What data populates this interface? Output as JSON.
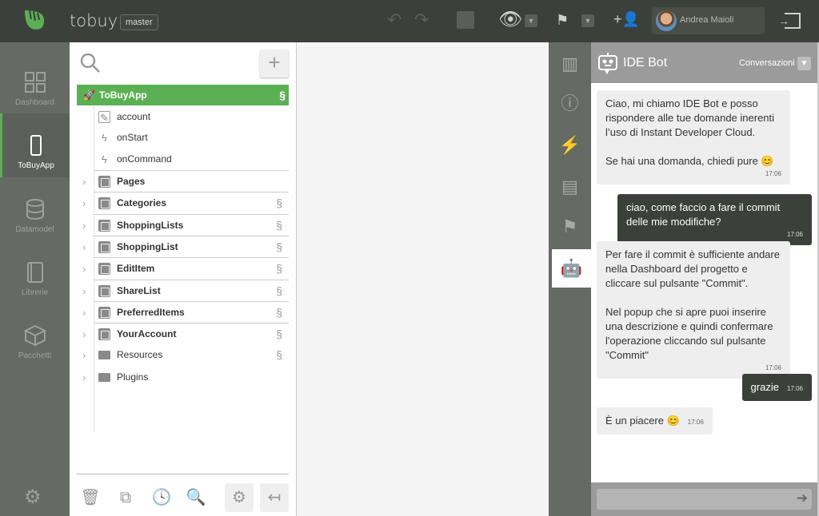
{
  "header": {
    "app_name": "tobuy",
    "branch": "master",
    "user_name": "Andrea Maioli",
    "icons": [
      "undo-icon",
      "redo-icon",
      "download-icon",
      "eye-icon",
      "signpost-icon",
      "add-user-icon",
      "logout-icon"
    ]
  },
  "leftnav": {
    "items": [
      {
        "label": "Dashboard"
      },
      {
        "label": "ToBuyApp",
        "active": true
      },
      {
        "label": "Datamodel"
      },
      {
        "label": "Librerie"
      },
      {
        "label": "Pacchetti"
      }
    ]
  },
  "tree": {
    "root": "ToBuyApp",
    "children": [
      {
        "label": "account",
        "icon": "pencil-icon"
      },
      {
        "label": "onStart",
        "icon": "bolt-icon"
      },
      {
        "label": "onCommand",
        "icon": "bolt-icon"
      }
    ],
    "items": [
      {
        "label": "Pages",
        "icon": "page-icon",
        "sync": false
      },
      {
        "label": "Categories",
        "icon": "page-icon",
        "sync": true
      },
      {
        "label": "ShoppingLists",
        "icon": "page-icon",
        "sync": true
      },
      {
        "label": "ShoppingList",
        "icon": "page-icon",
        "sync": true
      },
      {
        "label": "EditItem",
        "icon": "page-icon",
        "sync": true
      },
      {
        "label": "ShareList",
        "icon": "page-icon",
        "sync": true
      },
      {
        "label": "PreferredItems",
        "icon": "page-icon",
        "sync": true
      },
      {
        "label": "YourAccount",
        "icon": "page-icon",
        "sync": true
      },
      {
        "label": "Resources",
        "icon": "folder-icon",
        "sync": true
      },
      {
        "label": "Plugins",
        "icon": "folder-icon",
        "sync": false
      }
    ]
  },
  "chat": {
    "title": "IDE Bot",
    "conversations_label": "Conversazioni",
    "messages": [
      {
        "from": "bot",
        "text": "Ciao, mi chiamo IDE Bot e posso rispondere alle tue domande inerenti l’uso di Instant Developer Cloud.\n\nSe hai una domanda, chiedi pure 😊",
        "time": "17:06"
      },
      {
        "from": "me",
        "text": "ciao, come faccio a fare il commit delle mie modifiche?",
        "time": "17:06"
      },
      {
        "from": "bot",
        "text": "Per fare il commit è sufficiente andare nella Dashboard del progetto e cliccare sul pulsante \"Commit\".\n\nNel popup che si apre puoi inserire una descrizione e quindi confermare l'operazione cliccando sul pulsante \"Commit\"",
        "time": "17:06"
      },
      {
        "from": "me",
        "text": "grazie",
        "time": "17:06"
      },
      {
        "from": "bot",
        "text": "È un piacere 😊",
        "time": "17:06"
      }
    ],
    "input_value": ""
  },
  "colors": {
    "topbar": "#3c403a",
    "accent": "#5cb054",
    "nav": "#656a64",
    "chat_header": "#9b9b9b"
  }
}
